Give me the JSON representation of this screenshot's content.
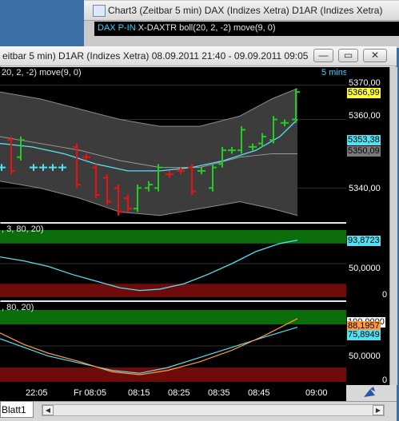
{
  "background_window": {
    "title": "Chart3 (Zeitbar 5 min)  DAX (Indizes Xetra) D1AR (Indizes Xetra)",
    "subheader_dax": "DAX P-IN",
    "subheader_ind": "X-DAXTR boll(20, 2, -2) move(9, 0)"
  },
  "window": {
    "title": "eitbar 5 min)  D1AR (Indizes Xetra) 08.09.2011 21:40 - 09.09.2011 09:05",
    "minimize": "—",
    "restore": "▭",
    "close": "✕"
  },
  "pane1": {
    "header": "20, 2, -2) move(9, 0)",
    "interval": "5 mins",
    "y_ticks": [
      "5370,00",
      "5360,00",
      "5340,00"
    ],
    "tags": {
      "t1": "5366,99",
      "t2": "5353,38",
      "t3": "5350,09"
    }
  },
  "pane2": {
    "header": ", 3, 80, 20)",
    "y_ticks": [
      "50,0000",
      "0"
    ],
    "tag": "93,8723"
  },
  "pane3": {
    "header": ", 80, 20)",
    "y_ticks": [
      "50,0000",
      "0"
    ],
    "tags": {
      "t1": "100,0000",
      "t2": "88,1957",
      "t3": "75,8949"
    }
  },
  "x_axis": [
    "22:05",
    "Fr 08:05",
    "08:15",
    "08:25",
    "08:35",
    "08:45",
    "09:00"
  ],
  "sheet_tab": "Blatt1",
  "colors": {
    "up": "#22cc22",
    "down": "#ee1111",
    "cyan": "#55e0f0",
    "orange": "#ff9a40",
    "green_band": "#0b6e0b",
    "red_band": "#6e0b0b"
  },
  "chart_data": [
    {
      "type": "line",
      "name": "price pane",
      "ylim": [
        5331,
        5372
      ],
      "bars": [
        {
          "x": 2,
          "o": 5346,
          "c": 5346
        },
        {
          "x": 14,
          "o": 5354,
          "c": 5345
        },
        {
          "x": 26,
          "o": 5349,
          "c": 5354
        },
        {
          "x": 42,
          "o": 5346,
          "c": 5346
        },
        {
          "x": 54,
          "o": 5346,
          "c": 5346
        },
        {
          "x": 66,
          "o": 5346,
          "c": 5346
        },
        {
          "x": 78,
          "o": 5346,
          "c": 5346
        },
        {
          "x": 96,
          "o": 5352,
          "c": 5341
        },
        {
          "x": 108,
          "o": 5349,
          "c": 5349
        },
        {
          "x": 120,
          "o": 5346,
          "c": 5338
        },
        {
          "x": 134,
          "o": 5343,
          "c": 5336
        },
        {
          "x": 148,
          "o": 5340,
          "c": 5333
        },
        {
          "x": 160,
          "o": 5337,
          "c": 5334
        },
        {
          "x": 172,
          "o": 5334,
          "c": 5340
        },
        {
          "x": 186,
          "o": 5340,
          "c": 5341
        },
        {
          "x": 198,
          "o": 5340,
          "c": 5346
        },
        {
          "x": 212,
          "o": 5344,
          "c": 5344
        },
        {
          "x": 226,
          "o": 5345,
          "c": 5345
        },
        {
          "x": 240,
          "o": 5346,
          "c": 5339
        },
        {
          "x": 252,
          "o": 5345,
          "c": 5345
        },
        {
          "x": 266,
          "o": 5340,
          "c": 5346
        },
        {
          "x": 278,
          "o": 5347,
          "c": 5351
        },
        {
          "x": 290,
          "o": 5351,
          "c": 5351
        },
        {
          "x": 302,
          "o": 5351,
          "c": 5357
        },
        {
          "x": 316,
          "o": 5352,
          "c": 5352
        },
        {
          "x": 328,
          "o": 5353,
          "c": 5355
        },
        {
          "x": 342,
          "o": 5354,
          "c": 5360
        },
        {
          "x": 356,
          "o": 5359,
          "c": 5359
        },
        {
          "x": 370,
          "o": 5360,
          "c": 5368
        }
      ],
      "bands": {
        "x": [
          0,
          50,
          100,
          150,
          200,
          250,
          300,
          340,
          372
        ],
        "upper": [
          5368,
          5366,
          5363,
          5360,
          5358,
          5358,
          5361,
          5366,
          5369
        ],
        "lower": [
          5342,
          5340,
          5337,
          5333,
          5332,
          5334,
          5336,
          5334,
          5332
        ],
        "middle": [
          5355,
          5353,
          5351,
          5348,
          5346,
          5346,
          5349,
          5350,
          5350
        ]
      },
      "ma": {
        "x": [
          0,
          40,
          80,
          120,
          160,
          200,
          240,
          280,
          320,
          350,
          372
        ],
        "y": [
          5353,
          5352,
          5350,
          5347,
          5345,
          5345,
          5346,
          5348,
          5351,
          5355,
          5360
        ]
      }
    },
    {
      "type": "line",
      "name": "oscillator 1",
      "ylim": [
        0,
        100
      ],
      "x": [
        0,
        30,
        60,
        90,
        120,
        150,
        175,
        200,
        230,
        260,
        290,
        320,
        350,
        372
      ],
      "y": [
        60,
        54,
        46,
        34,
        24,
        14,
        10,
        12,
        20,
        34,
        50,
        68,
        80,
        85
      ]
    },
    {
      "type": "line",
      "name": "oscillator 2",
      "ylim": [
        0,
        100
      ],
      "series": [
        {
          "color": "cyan",
          "x": [
            0,
            30,
            60,
            100,
            140,
            175,
            210,
            250,
            290,
            330,
            372
          ],
          "y": [
            60,
            48,
            36,
            26,
            16,
            12,
            20,
            34,
            48,
            62,
            76
          ]
        },
        {
          "color": "orange",
          "x": [
            0,
            30,
            60,
            100,
            140,
            175,
            210,
            250,
            290,
            330,
            372
          ],
          "y": [
            68,
            52,
            40,
            28,
            14,
            10,
            16,
            28,
            44,
            64,
            88
          ]
        }
      ]
    }
  ]
}
